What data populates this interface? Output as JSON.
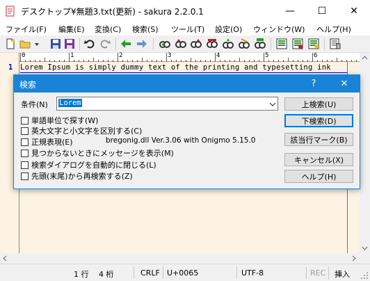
{
  "window": {
    "title": "デスクトップ¥無題3.txt(更新) - sakura 2.2.0.1",
    "minimize_glyph": "—",
    "maximize_glyph": "☐",
    "close_glyph": "✕"
  },
  "menu": [
    "ファイル(F)",
    "編集(E)",
    "変換(C)",
    "検索(S)",
    "ツール(T)",
    "設定(O)",
    "ウィンドウ(W)",
    "ヘルプ(H)"
  ],
  "toolbar": {
    "icons": [
      "new-file-icon",
      "open-folder-icon",
      "dropdown-icon",
      "save-icon",
      "save-all-icon",
      "undo-icon",
      "redo-icon",
      "jump-prev-icon",
      "jump-next-icon",
      "search-icon",
      "find-prev-icon",
      "find-next-icon",
      "replace-icon",
      "mark-icon",
      "clear-mark-icon",
      "grep-icon",
      "print-icon",
      "compare-icon",
      "outline-icon",
      "settings-icon"
    ]
  },
  "editor": {
    "ruler_numbers": [
      "0",
      "1",
      "2",
      "3",
      "4",
      "5",
      "6"
    ],
    "line_number": "1",
    "line_text": "Lorem Ipsum is simply dummy text of the printing and typesetting ink"
  },
  "dialog": {
    "title": "検索",
    "help_glyph": "?",
    "close_glyph": "✕",
    "condition_label": "条件(N)",
    "search_value": "Lorem",
    "buttons": {
      "search_up": "上検索(U)",
      "search_down": "下検索(D)",
      "mark_lines": "該当行マーク(B)",
      "cancel": "キャンセル(X)",
      "help": "ヘルプ(H)"
    },
    "options": [
      {
        "label": "単語単位で探す(W)",
        "checked": false
      },
      {
        "label": "英大文字と小文字を区別する(C)",
        "checked": false
      },
      {
        "label": "正規表現(E)",
        "checked": false
      },
      {
        "label": "見つからないときにメッセージを表示(M)",
        "checked": false
      },
      {
        "label": "検索ダイアログを自動的に閉じる(L)",
        "checked": false
      },
      {
        "label": "先頭(末尾)から再検索する(Z)",
        "checked": false
      }
    ],
    "regex_library": "bregonig.dll Ver.3.06 with Onigmo 5.15.0"
  },
  "status": {
    "position": "1 行　 4 桁",
    "line_ending": "CRLF",
    "char_code": "U+0065",
    "encoding": "UTF-8",
    "rec": "REC",
    "insert_mode": "挿入"
  },
  "colors": {
    "accent": "#1883d7",
    "editor_bg": "#fcf3e4",
    "line_number": "#0000c8",
    "wrap_guide": "#a050c8"
  }
}
